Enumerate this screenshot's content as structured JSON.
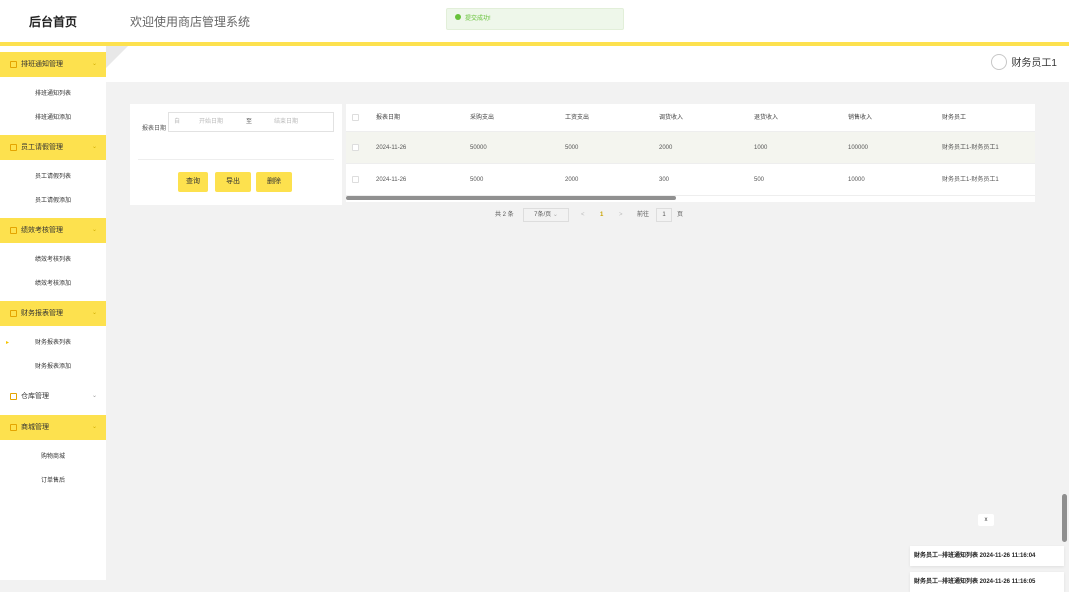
{
  "header": {
    "brand": "后台首页",
    "welcome": "欢迎使用商店管理系统",
    "toast": "提交成功!"
  },
  "user": {
    "name": "财务员工1"
  },
  "sidebar": {
    "groups": [
      {
        "label": "排班通知管理",
        "items": [
          "排班通知列表",
          "排班通知添加"
        ]
      },
      {
        "label": "员工请假管理",
        "items": [
          "员工请假列表",
          "员工请假添加"
        ]
      },
      {
        "label": "绩效考核管理",
        "items": [
          "绩效考核列表",
          "绩效考核添加"
        ]
      },
      {
        "label": "财务报表管理",
        "items": [
          "财务报表列表",
          "财务报表添加"
        ]
      },
      {
        "label": "仓库管理",
        "items": []
      },
      {
        "label": "商城管理",
        "items": [
          "购物商城",
          "订单售后"
        ]
      }
    ],
    "active_item": "财务报表列表"
  },
  "filter": {
    "label": "报表日期",
    "from_prefix": "自",
    "start_placeholder": "开始日期",
    "separator": "至",
    "end_placeholder": "结束日期",
    "buttons": {
      "query": "查询",
      "export": "导出",
      "delete": "删除"
    }
  },
  "table": {
    "columns": [
      "报表日期",
      "采购支出",
      "工资支出",
      "调货收入",
      "退货收入",
      "销售收入",
      "财务员工"
    ],
    "rows": [
      [
        "2024-11-26",
        "50000",
        "5000",
        "2000",
        "1000",
        "100000",
        "财务员工1-财务员工1"
      ],
      [
        "2024-11-26",
        "5000",
        "2000",
        "300",
        "500",
        "10000",
        "财务员工1-财务员工1"
      ]
    ]
  },
  "pagination": {
    "total": "共 2 条",
    "page_size": "7条/页",
    "prev": "<",
    "current": "1",
    "next": ">",
    "goto_label": "前往",
    "goto_value": "1",
    "page_suffix": "页"
  },
  "notifications": {
    "close": "x",
    "items": [
      "财务员工--排班通知列表 2024-11-26 11:16:04",
      "财务员工--排班通知列表 2024-11-26 11:16:05"
    ]
  },
  "colors": {
    "accent": "#fde14e",
    "success": "#67c23a"
  }
}
